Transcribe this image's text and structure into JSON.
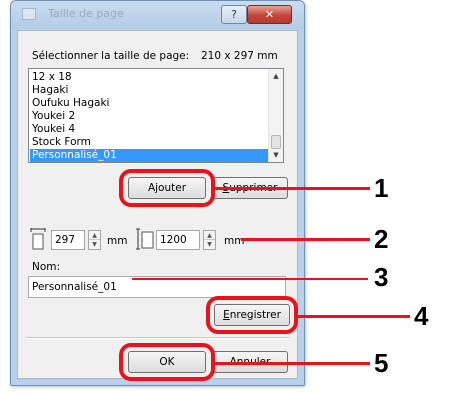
{
  "dialog": {
    "title": "Taille de page",
    "help_label": "?",
    "close_label": "✕"
  },
  "page_size": {
    "label": "Sélectionner la taille de page:",
    "current_value": "210 x 297 mm"
  },
  "list": {
    "items": [
      "12 x 18",
      "Hagaki",
      "Oufuku Hagaki",
      "Youkei 2",
      "Youkei 4",
      "Stock Form",
      "Personnalisé_01"
    ],
    "selected_index": 6
  },
  "buttons": {
    "add_label": "Ajouter",
    "delete_prefix": "S",
    "delete_rest": "upprimer",
    "save_prefix": "E",
    "save_rest": "nregistrer",
    "ok_label": "OK",
    "cancel_label": "Annuler"
  },
  "dimensions": {
    "width_value": "297",
    "width_unit": "mm",
    "height_value": "1200",
    "height_unit": "mm"
  },
  "name_field": {
    "label": "Nom:",
    "value": "Personnalisé_01"
  },
  "callouts": [
    "1",
    "2",
    "3",
    "4",
    "5"
  ],
  "colors": {
    "callout_red": "#e8131b",
    "selection_blue": "#3399ff",
    "frame_blue": "#b9d1ea"
  }
}
